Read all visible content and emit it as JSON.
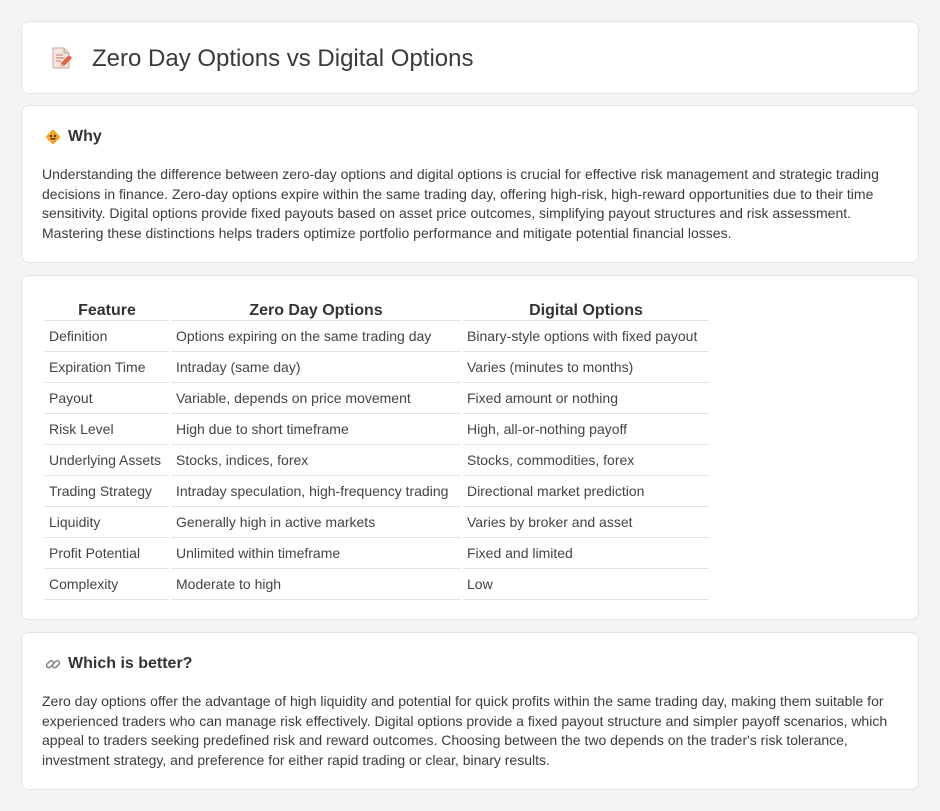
{
  "header": {
    "title": "Zero Day Options vs Digital Options",
    "icon": "document-pencil-icon"
  },
  "why": {
    "title": "Why",
    "icon": "diamond-sign-icon",
    "body": "Understanding the difference between zero-day options and digital options is crucial for effective risk management and strategic trading decisions in finance. Zero-day options expire within the same trading day, offering high-risk, high-reward opportunities due to their time sensitivity. Digital options provide fixed payouts based on asset price outcomes, simplifying payout structures and risk assessment. Mastering these distinctions helps traders optimize portfolio performance and mitigate potential financial losses."
  },
  "table": {
    "headers": [
      "Feature",
      "Zero Day Options",
      "Digital Options"
    ],
    "rows": [
      [
        "Definition",
        "Options expiring on the same trading day",
        "Binary-style options with fixed payout"
      ],
      [
        "Expiration Time",
        "Intraday (same day)",
        "Varies (minutes to months)"
      ],
      [
        "Payout",
        "Variable, depends on price movement",
        "Fixed amount or nothing"
      ],
      [
        "Risk Level",
        "High due to short timeframe",
        "High, all-or-nothing payoff"
      ],
      [
        "Underlying Assets",
        "Stocks, indices, forex",
        "Stocks, commodities, forex"
      ],
      [
        "Trading Strategy",
        "Intraday speculation, high-frequency trading",
        "Directional market prediction"
      ],
      [
        "Liquidity",
        "Generally high in active markets",
        "Varies by broker and asset"
      ],
      [
        "Profit Potential",
        "Unlimited within timeframe",
        "Fixed and limited"
      ],
      [
        "Complexity",
        "Moderate to high",
        "Low"
      ]
    ]
  },
  "better": {
    "title": "Which is better?",
    "icon": "link-icon",
    "body": "Zero day options offer the advantage of high liquidity and potential for quick profits within the same trading day, making them suitable for experienced traders who can manage risk effectively. Digital options provide a fixed payout structure and simpler payoff scenarios, which appeal to traders seeking predefined risk and reward outcomes. Choosing between the two depends on the trader's risk tolerance, investment strategy, and preference for either rapid trading or clear, binary results."
  },
  "colors": {
    "background": "#f3f4f6",
    "card": "#ffffff",
    "accent": "#f5a623"
  }
}
